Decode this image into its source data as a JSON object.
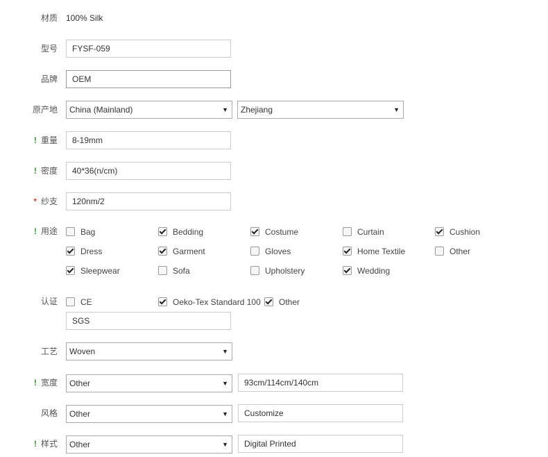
{
  "material": {
    "label": "材质",
    "value": "100% Silk"
  },
  "model": {
    "label": "型号",
    "value": "FYSF-059"
  },
  "brand": {
    "label": "品牌",
    "value": "OEM"
  },
  "origin": {
    "label": "原产地",
    "country": "China (Mainland)",
    "province": "Zhejiang"
  },
  "weight": {
    "marker": "!",
    "label": "重量",
    "value": "8-19mm"
  },
  "density": {
    "marker": "!",
    "label": "密度",
    "value": "40*36(n/cm)"
  },
  "yarn": {
    "marker": "*",
    "label": "纱支",
    "value": "120nm/2"
  },
  "usage": {
    "marker": "!",
    "label": "用途",
    "options": [
      {
        "label": "Bag",
        "checked": false
      },
      {
        "label": "Bedding",
        "checked": true
      },
      {
        "label": "Costume",
        "checked": true
      },
      {
        "label": "Curtain",
        "checked": false
      },
      {
        "label": "Cushion",
        "checked": true
      },
      {
        "label": "Dress",
        "checked": true
      },
      {
        "label": "Garment",
        "checked": true
      },
      {
        "label": "Gloves",
        "checked": false
      },
      {
        "label": "Home Textile",
        "checked": true
      },
      {
        "label": "Other",
        "checked": false
      },
      {
        "label": "Sleepwear",
        "checked": true
      },
      {
        "label": "Sofa",
        "checked": false
      },
      {
        "label": "Upholstery",
        "checked": false
      },
      {
        "label": "Wedding",
        "checked": true
      }
    ]
  },
  "certification": {
    "label": "认证",
    "options": [
      {
        "label": "CE",
        "checked": false
      },
      {
        "label": "Oeko-Tex Standard 100",
        "checked": true
      },
      {
        "label": "Other",
        "checked": true
      }
    ],
    "other_value": "SGS"
  },
  "technique": {
    "label": "工艺",
    "selected": "Woven"
  },
  "width": {
    "marker": "!",
    "label": "宽度",
    "selected": "Other",
    "custom": "93cm/114cm/140cm"
  },
  "style": {
    "label": "风格",
    "selected": "Other",
    "custom": "Customize"
  },
  "pattern": {
    "marker": "!",
    "label": "样式",
    "selected": "Other",
    "custom": "Digital Printed"
  },
  "icons": {
    "dropdown": "triangle-down-icon",
    "checkbox": "checkbox-icon"
  }
}
